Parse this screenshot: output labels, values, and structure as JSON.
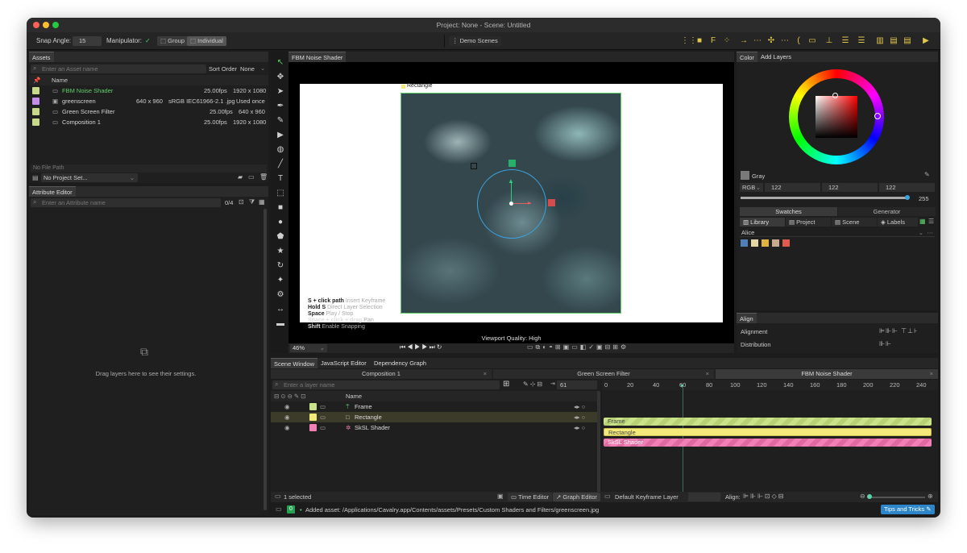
{
  "window": {
    "title": "Project: None - Scene: Untitled"
  },
  "toolbar": {
    "snap_angle_label": "Snap Angle:",
    "snap_angle_value": "15",
    "manipulator_label": "Manipulator:",
    "group_label": "Group",
    "individual_label": "Individual",
    "demo_scenes_label": "Demo Scenes"
  },
  "assets": {
    "tab": "Assets",
    "search_placeholder": "Enter an Asset name",
    "sort_order_label": "Sort Order",
    "sort_order_value": "None",
    "name_header": "Name",
    "items": [
      {
        "name": "FBM Noise Shader",
        "info1": "",
        "info2": "25.00fps",
        "info3": "1920 x 1080",
        "color": "#c9d98a",
        "name_color": "#5fd16a"
      },
      {
        "name": "greenscreen",
        "info1": "640 x 960",
        "info2": "sRGB IEC61966-2.1  .jpg",
        "info3": "Used once",
        "color": "#c58de8",
        "name_color": "#d4d4d4"
      },
      {
        "name": "Green Screen Filter",
        "info1": "",
        "info2": "25.00fps",
        "info3": "640 x 960",
        "color": "#c9d98a",
        "name_color": "#d4d4d4"
      },
      {
        "name": "Composition 1",
        "info1": "",
        "info2": "25.00fps",
        "info3": "1920 x 1080",
        "color": "#c9d98a",
        "name_color": "#d4d4d4"
      }
    ],
    "file_path": "No File Path",
    "project_set": "No Project Set..."
  },
  "attribute_editor": {
    "tab": "Attribute Editor",
    "search_placeholder": "Enter an Attribute name",
    "count": "0/4",
    "empty_message": "Drag layers here to see their settings."
  },
  "viewport": {
    "tab": "FBM Noise Shader",
    "layer_label": "Rectangle",
    "quality": "Viewport Quality: High",
    "zoom": "46%",
    "hints": [
      {
        "key": "S + click path",
        "desc": "Insert Keyframe"
      },
      {
        "key": "Hold S",
        "desc": "Direct Layer Selection"
      },
      {
        "key": "Space",
        "desc": "Play / Stop"
      },
      {
        "key": "Space + click + drag",
        "desc": "Pan"
      },
      {
        "key": "Shift",
        "desc": "Enable Snapping"
      }
    ]
  },
  "color_panel": {
    "tabs": [
      "Color",
      "Add Layers"
    ],
    "color_name": "Gray",
    "mode": "RGB",
    "r": "122",
    "g": "122",
    "b": "122",
    "alpha": "255",
    "swatches_tab": "Swatches",
    "generator_tab": "Generator",
    "subtabs": [
      "Library",
      "Project",
      "Scene",
      "Labels"
    ],
    "palette_name": "Alice",
    "palette": [
      "#4f7fb5",
      "#e3d7a5",
      "#e0b442",
      "#c9a98e",
      "#e05a4d"
    ]
  },
  "align_panel": {
    "tab": "Align",
    "alignment_label": "Alignment",
    "distribution_label": "Distribution"
  },
  "bottom_tabs": [
    "Scene Window",
    "JavaScript Editor",
    "Dependency Graph"
  ],
  "comp_tabs": [
    "Composition 1",
    "Green Screen Filter",
    "FBM Noise Shader"
  ],
  "scene": {
    "search_placeholder": "Enter a layer name",
    "frame": "61",
    "name_header": "Name",
    "layers": [
      {
        "name": "Frame",
        "color": "#c9e38a"
      },
      {
        "name": "Rectangle",
        "color": "#f3ea7a"
      },
      {
        "name": "SkSL Shader",
        "color": "#f27fb5"
      }
    ],
    "selected_count": "1 selected",
    "time_editor": "Time Editor",
    "graph_editor": "Graph Editor"
  },
  "timeline": {
    "ticks": [
      "0",
      "20",
      "40",
      "60",
      "80",
      "100",
      "120",
      "140",
      "160",
      "180",
      "200",
      "220",
      "240"
    ],
    "bars": [
      "Frame",
      "Rectangle",
      "SkSL Shader"
    ],
    "keyframe_layer": "Default Keyframe Layer",
    "align_label": "Align:"
  },
  "status": {
    "badge": "0",
    "message": "Added asset: /Applications/Cavalry.app/Contents/assets/Presets/Custom Shaders and Filters/greenscreen.jpg",
    "tips": "Tips and Tricks"
  }
}
